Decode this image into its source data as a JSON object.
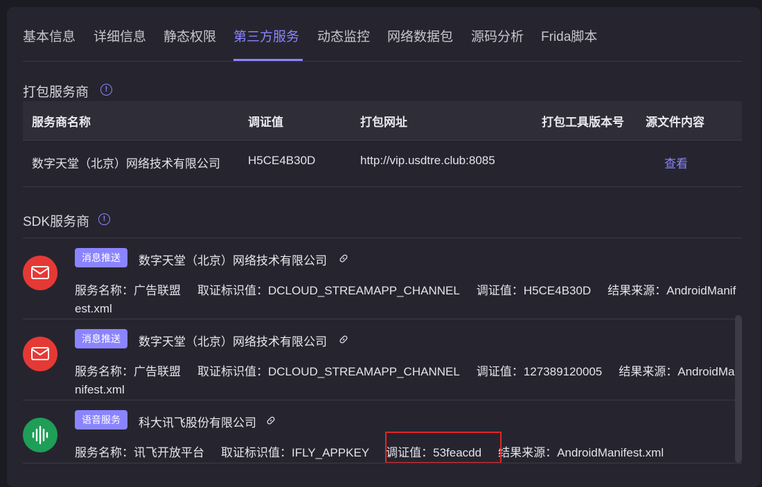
{
  "tabs": [
    "基本信息",
    "详细信息",
    "静态权限",
    "第三方服务",
    "动态监控",
    "网络数据包",
    "源码分析",
    "Frida脚本"
  ],
  "active_tab": "第三方服务",
  "packaging": {
    "title": "打包服务商",
    "headers": [
      "服务商名称",
      "调证值",
      "打包网址",
      "打包工具版本号",
      "源文件内容"
    ],
    "row": {
      "name": "数字天堂（北京）网络技术有限公司",
      "value": "H5CE4B30D",
      "url": "http://vip.usdtre.club:8085",
      "version": "",
      "link": "查看"
    }
  },
  "sdk": {
    "title": "SDK服务商",
    "items": [
      {
        "icon": "message-push-icon",
        "icon_color": "#e53935",
        "badge": "消息推送",
        "company": "数字天堂（北京）网络技术有限公司",
        "service_name": "服务名称：广告联盟",
        "identifier": "取证标识值：DCLOUD_STREAMAPP_CHANNEL",
        "value": "调证值：H5CE4B30D",
        "source": "结果来源：AndroidManifest.xml"
      },
      {
        "icon": "message-push-icon",
        "icon_color": "#e53935",
        "badge": "消息推送",
        "company": "数字天堂（北京）网络技术有限公司",
        "service_name": "服务名称：广告联盟",
        "identifier": "取证标识值：DCLOUD_STREAMAPP_CHANNEL",
        "value": "调证值：127389120005",
        "source": "结果来源：AndroidManifest.xml"
      },
      {
        "icon": "voice-wave-icon",
        "icon_color": "#1e9e57",
        "badge": "语音服务",
        "company": "科大讯飞股份有限公司",
        "service_name": "服务名称：讯飞开放平台",
        "identifier": "取证标识值：IFLY_APPKEY",
        "value": "调证值：53feacdd",
        "source": "结果来源：AndroidManifest.xml"
      }
    ]
  },
  "colors": {
    "accent": "#8b84ff",
    "highlight": "#e0262a",
    "panel": "#26252f"
  }
}
